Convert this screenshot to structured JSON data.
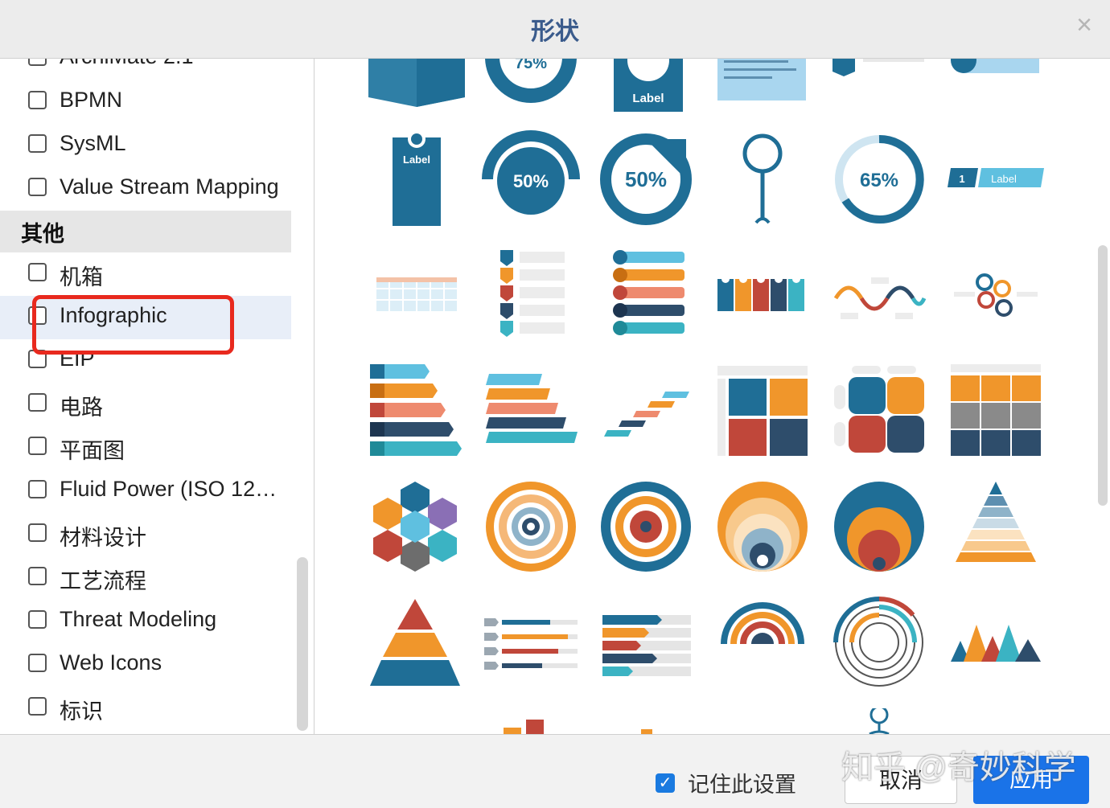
{
  "dialog": {
    "title": "形状",
    "close_symbol": "×"
  },
  "sidebar": {
    "items_top": [
      {
        "label": "ArchiMate 2.1"
      },
      {
        "label": "BPMN"
      },
      {
        "label": "SysML"
      },
      {
        "label": "Value Stream Mapping"
      }
    ],
    "section": "其他",
    "items": [
      {
        "label": "机箱"
      },
      {
        "label": "Infographic"
      },
      {
        "label": "EIP"
      },
      {
        "label": "电路"
      },
      {
        "label": "平面图"
      },
      {
        "label": "Fluid Power (ISO 12…"
      },
      {
        "label": "材料设计"
      },
      {
        "label": "工艺流程"
      },
      {
        "label": "Threat Modeling"
      },
      {
        "label": "Web Icons"
      },
      {
        "label": "标识"
      }
    ]
  },
  "gallery": {
    "texts": {
      "pct_75": "75%",
      "pct_50": "50%",
      "pct_65": "65%",
      "label": "Label",
      "num_1": "1"
    },
    "colors": {
      "blue": "#1f6e96",
      "light_blue": "#4aa3c9",
      "orange": "#f0962b",
      "red": "#c0473a",
      "navy": "#2e4d6b",
      "teal": "#3bb3c3",
      "salmon": "#ee8a6e",
      "purple": "#8a6fb5"
    }
  },
  "footer": {
    "remember_label": "记住此设置",
    "remember_checked": true,
    "cancel_label": "取消",
    "apply_label": "应用"
  },
  "watermark": "知乎 @奇妙科学"
}
